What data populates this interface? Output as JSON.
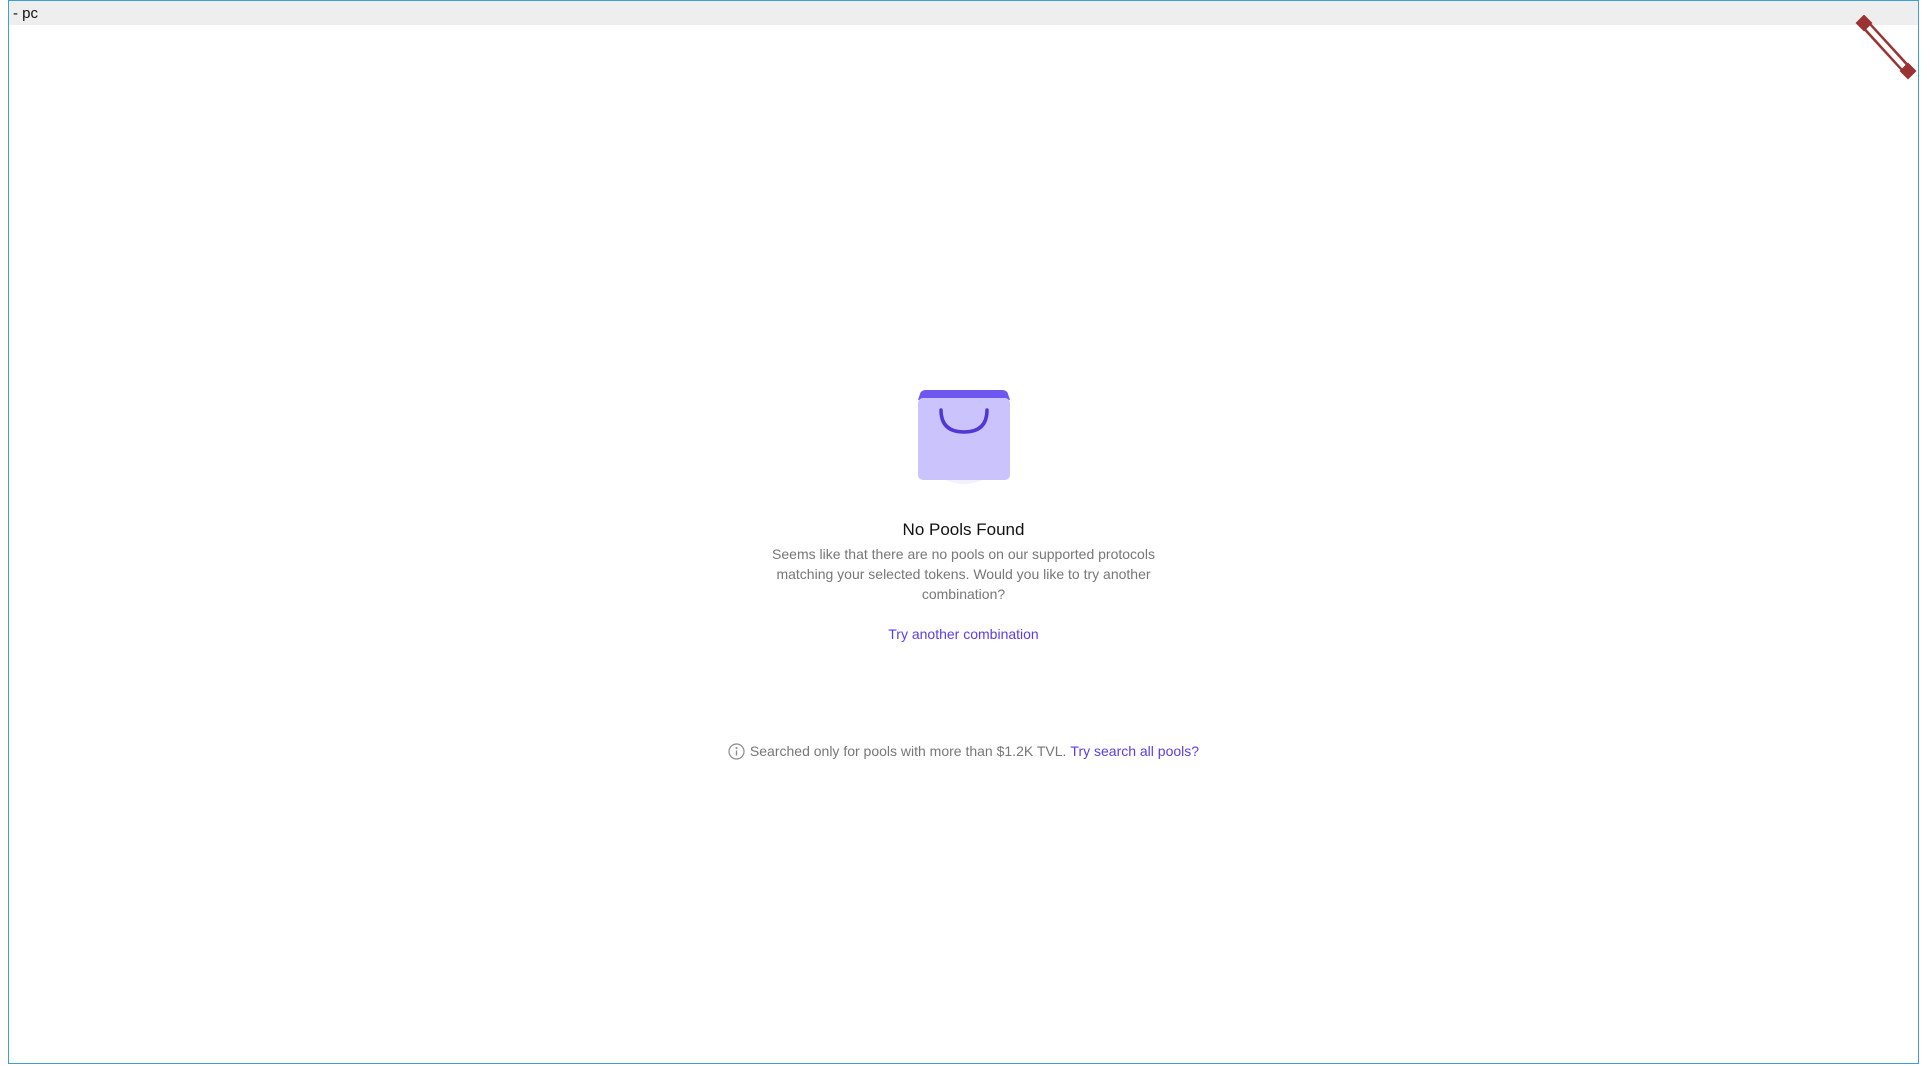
{
  "frame": {
    "label": "- pc"
  },
  "empty_state": {
    "icon": "shopping-bag-icon",
    "title": "No Pools Found",
    "description": "Seems like that there are no pools on our supported protocols matching your selected tokens. Would you like to try another combination?",
    "action_label": "Try another combination"
  },
  "tvl_note": {
    "icon": "info-icon",
    "text": "Searched only for pools with more than $1.2K TVL.",
    "link_label": "Try search all pools?"
  },
  "colors": {
    "accent": "#5b3de8",
    "bag_body": "#cbc3fb",
    "bag_top": "#6e57ef",
    "frame_border": "#3aa0d6",
    "handle": "#9a3434"
  }
}
